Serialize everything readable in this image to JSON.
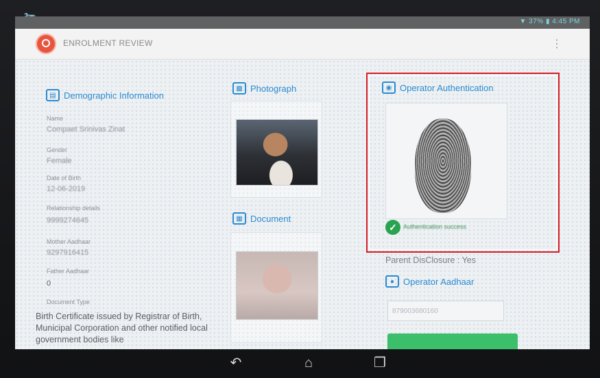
{
  "app": {
    "title": "ENROLMENT REVIEW",
    "status_right": "▼ 37% ▮ 4:45 PM"
  },
  "demographic": {
    "heading": "Demographic Information",
    "fields": [
      {
        "label": "Name",
        "value": "Compaet Srinivas Zinat"
      },
      {
        "label": "Gender",
        "value": "Female"
      },
      {
        "label": "Date of Birth",
        "value": "12-06-2019"
      },
      {
        "label": "Relationship details",
        "value": "9999274645"
      },
      {
        "label": "Mother Aadhaar",
        "value": "9297916415"
      },
      {
        "label": "Father Aadhaar",
        "value": "0"
      },
      {
        "label": "Document Type",
        "value": ""
      }
    ],
    "document_type_text": "Birth Certificate issued by Registrar of Birth, Municipal Corporation and other notified local government bodies like"
  },
  "photograph": {
    "heading": "Photograph"
  },
  "document": {
    "heading": "Document"
  },
  "operator_auth": {
    "heading": "Operator Authentication",
    "status": "Authentication success"
  },
  "parent_consent": {
    "label": "Parent DisClosure : Yes"
  },
  "operator_aadhaar": {
    "heading": "Operator Aadhaar",
    "value": "879003680160"
  },
  "icons": {
    "wrench": "wrench-icon",
    "logo": "uidai-logo",
    "overflow": "overflow-menu-icon",
    "back": "back-icon",
    "home": "home-icon",
    "recents": "recents-icon",
    "check": "check-circle-icon"
  },
  "colors": {
    "accent": "#2a8bd0",
    "highlight": "#d51b24",
    "success": "#29a34f",
    "button": "#3bbf6b"
  }
}
